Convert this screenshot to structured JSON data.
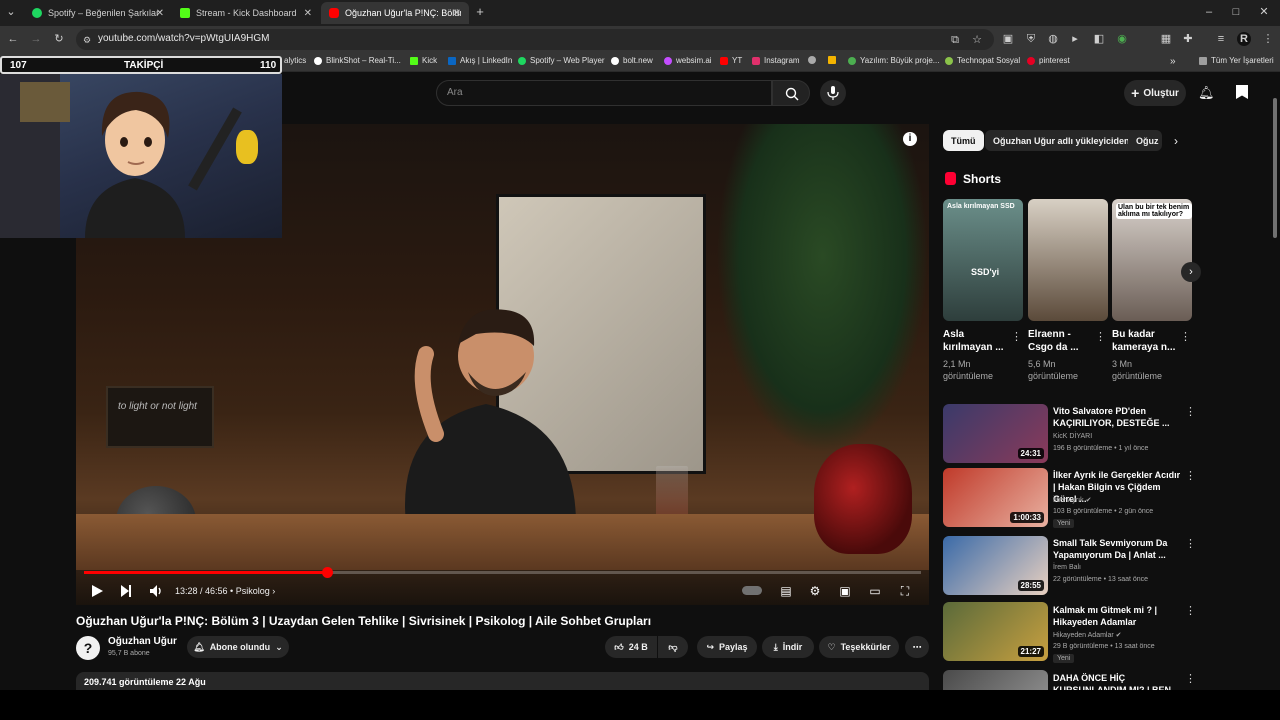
{
  "browser": {
    "tabs": [
      {
        "title": "Spotify – Beğenilen Şarkılar",
        "color": "#1ed760"
      },
      {
        "title": "Stream - Kick Dashboard",
        "color": "#53fc18"
      },
      {
        "title": "Oğuzhan Uğur'la P!NÇ: Bölüm",
        "color": "#ff0000"
      }
    ],
    "new_tab": "+",
    "url": "youtube.com/watch?v=pWtgUIA9HGM",
    "window": {
      "min": "–",
      "max": "□",
      "close": "✕"
    }
  },
  "bookmarks": [
    {
      "label": "alytics",
      "color": "#888888"
    },
    {
      "label": "BlinkShot – Real-Ti...",
      "color": "#ffffff"
    },
    {
      "label": "Kick",
      "color": "#53fc18"
    },
    {
      "label": "Akış | LinkedIn",
      "color": "#0a66c2"
    },
    {
      "label": "Spotify – Web Player",
      "color": "#1ed760"
    },
    {
      "label": "bolt.new",
      "color": "#ffffff"
    },
    {
      "label": "websim.ai",
      "color": "#c44dff"
    },
    {
      "label": "YT",
      "color": "#ff0000"
    },
    {
      "label": "Instagram",
      "color": "#e1306c"
    },
    {
      "label": "Yazılım: Büyük proje...",
      "color": "#4caf50"
    },
    {
      "label": "Technopat Sosyal",
      "color": "#8bc34a"
    },
    {
      "label": "pinterest",
      "color": "#e60023"
    }
  ],
  "all_bookmarks": "Tüm Yer İşaretleri",
  "overlay": {
    "left_count": "107",
    "label": "TAKİPÇİ",
    "right_count": "110"
  },
  "header": {
    "search_placeholder": "Ara",
    "create_label": "Oluştur"
  },
  "player": {
    "time": "13:28 / 46:56",
    "chapter": "Psikolog",
    "progress": 0.29
  },
  "video": {
    "title": "Oğuzhan Uğur'la P!NÇ: Bölüm 3 | Uzaydan Gelen Tehlike | Sivrisinek | Psikolog | Aile Sohbet Grupları",
    "channel": "Oğuzhan Uğur",
    "subscribers": "95,7 B abone",
    "subscribe_label": "Abone olundu",
    "likes": "24 B",
    "share": "Paylaş",
    "download": "İndir",
    "thanks": "Teşekkürler",
    "views_date": "209.741 görüntüleme  22 Ağu"
  },
  "chips": [
    "Tümü",
    "Oğuzhan Uğur adlı yükleyiciden",
    "Oğuz"
  ],
  "shorts": {
    "title": "Shorts",
    "items": [
      {
        "caption": "Asla kırılmayan SSD",
        "title": "Asla kırılmayan ...",
        "views": "2,1 Mn görüntüleme",
        "color1": "#6b8f8a",
        "color2": "#2e3e3c"
      },
      {
        "caption": "",
        "title": "Elraenn - Csgo da ...",
        "views": "5,6 Mn görüntüleme",
        "color1": "#d8d0c4",
        "color2": "#5b4a3a"
      },
      {
        "caption": "Ulan bu bir tek benim aklıma mı takılıyor?",
        "title": "Bu kadar kameraya n...",
        "views": "3 Mn görüntüleme",
        "color1": "#d9d2cc",
        "color2": "#6a5d55"
      }
    ]
  },
  "recommended": [
    {
      "title": "Vito Salvatore PD'den KAÇIRILIYOR, DESTEĞE ...",
      "channel": "KicK DİYARI",
      "meta": "196 B görüntüleme • 1 yıl önce",
      "duration": "24:31",
      "badge": "",
      "color1": "#3a3a6a",
      "color2": "#8a3a5a"
    },
    {
      "title": "İlker Ayrık ile Gerçekler Acıdır | Hakan Bilgin vs Çiğdem Gürel ...",
      "channel": "İlker Ayrık",
      "meta": "103 B görüntüleme • 2 gün önce",
      "duration": "1:00:33",
      "badge": "Yeni",
      "color1": "#c03a2a",
      "color2": "#e8b0a0"
    },
    {
      "title": "Small Talk Sevmiyorum Da Yapamıyorum Da | Anlat ...",
      "channel": "İrem Balı",
      "meta": "22 görüntüleme • 13 saat önce",
      "duration": "28:55",
      "badge": "",
      "color1": "#3a6aa8",
      "color2": "#e8d0c0"
    },
    {
      "title": "Kalmak mı Gitmek mi ? | Hikayeden Adamlar",
      "channel": "Hikayeden Adamlar",
      "meta": "29 B görüntüleme • 13 saat önce",
      "duration": "21:27",
      "badge": "Yeni",
      "color1": "#5a6a3a",
      "color2": "#c8a040"
    },
    {
      "title": "DAHA ÖNCE HİÇ KURSUNLANDIM MI? | BEN...",
      "channel": "",
      "meta": "",
      "duration": "",
      "badge": "",
      "color1": "#4a4a4a",
      "color2": "#888888"
    }
  ],
  "overlay_texts": {
    "short1_badge": "SSD'yi",
    "video_caption": "to light or not light"
  }
}
